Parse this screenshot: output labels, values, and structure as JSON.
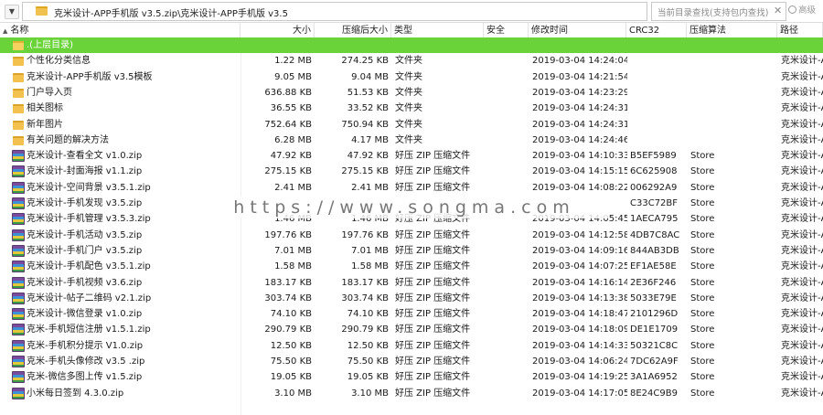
{
  "address": {
    "path": "克米设计-APP手机版 v3.5.zip\\克米设计-APP手机版 v3.5",
    "search_placeholder": "当前目录查找(支持包内查找)",
    "search_clear": "✕",
    "search_button": "高级"
  },
  "columns": {
    "name": "名称",
    "size": "大小",
    "packed": "压缩后大小",
    "type": "类型",
    "security": "安全",
    "modified": "修改时间",
    "crc": "CRC32",
    "algo": "压缩算法",
    "path": "路径"
  },
  "rows": [
    {
      "icon": "up",
      "name": ".(上层目录)",
      "size": "",
      "packed": "",
      "type": "",
      "modified": "",
      "crc": "",
      "algo": "",
      "path": ""
    },
    {
      "icon": "folder",
      "name": "个性化分类信息",
      "size": "1.22 MB",
      "packed": "274.25 KB",
      "type": "文件夹",
      "modified": "2019-03-04 14:24:04",
      "crc": "",
      "algo": "",
      "path": "克米设计-A"
    },
    {
      "icon": "folder",
      "name": "克米设计-APP手机版 v3.5模板",
      "size": "9.05 MB",
      "packed": "9.04 MB",
      "type": "文件夹",
      "modified": "2019-03-04 14:21:54",
      "crc": "",
      "algo": "",
      "path": "克米设计-A"
    },
    {
      "icon": "folder",
      "name": "门户导入页",
      "size": "636.88 KB",
      "packed": "51.53 KB",
      "type": "文件夹",
      "modified": "2019-03-04 14:23:29",
      "crc": "",
      "algo": "",
      "path": "克米设计-A"
    },
    {
      "icon": "folder",
      "name": "相关图标",
      "size": "36.55 KB",
      "packed": "33.52 KB",
      "type": "文件夹",
      "modified": "2019-03-04 14:24:31",
      "crc": "",
      "algo": "",
      "path": "克米设计-A"
    },
    {
      "icon": "folder",
      "name": "新年图片",
      "size": "752.64 KB",
      "packed": "750.94 KB",
      "type": "文件夹",
      "modified": "2019-03-04 14:24:31",
      "crc": "",
      "algo": "",
      "path": "克米设计-A"
    },
    {
      "icon": "folder",
      "name": "有关问题的解决方法",
      "size": "6.28 MB",
      "packed": "4.17 MB",
      "type": "文件夹",
      "modified": "2019-03-04 14:24:46",
      "crc": "",
      "algo": "",
      "path": "克米设计-A"
    },
    {
      "icon": "zip",
      "name": "克米设计-查看全文 v1.0.zip",
      "size": "47.92 KB",
      "packed": "47.92 KB",
      "type": "好压 ZIP 压缩文件",
      "modified": "2019-03-04 14:10:33",
      "crc": "B5EF5989",
      "algo": "Store",
      "path": "克米设计-A"
    },
    {
      "icon": "zip",
      "name": "克米设计-封面海报 v1.1.zip",
      "size": "275.15 KB",
      "packed": "275.15 KB",
      "type": "好压 ZIP 压缩文件",
      "modified": "2019-03-04 14:15:15",
      "crc": "6C625908",
      "algo": "Store",
      "path": "克米设计-A"
    },
    {
      "icon": "zip",
      "name": "克米设计-空间背景 v3.5.1.zip",
      "size": "2.41 MB",
      "packed": "2.41 MB",
      "type": "好压 ZIP 压缩文件",
      "modified": "2019-03-04 14:08:22",
      "crc": "006292A9",
      "algo": "Store",
      "path": "克米设计-A"
    },
    {
      "icon": "zip",
      "name": "克米设计-手机发现 v3.5.zip",
      "size": "",
      "packed": "",
      "type": "",
      "modified": "",
      "crc": "C33C72BF",
      "algo": "Store",
      "path": "克米设计-A"
    },
    {
      "icon": "zip",
      "name": "克米设计-手机管理 v3.5.3.zip",
      "size": "1.46 MB",
      "packed": "1.46 MB",
      "type": "好压 ZIP 压缩文件",
      "modified": "2019-03-04 14:05:45",
      "crc": "1AECA795",
      "algo": "Store",
      "path": "克米设计-A"
    },
    {
      "icon": "zip",
      "name": "克米设计-手机活动 v3.5.zip",
      "size": "197.76 KB",
      "packed": "197.76 KB",
      "type": "好压 ZIP 压缩文件",
      "modified": "2019-03-04 14:12:58",
      "crc": "4DB7C8AC",
      "algo": "Store",
      "path": "克米设计-A"
    },
    {
      "icon": "zip",
      "name": "克米设计-手机门户 v3.5.zip",
      "size": "7.01 MB",
      "packed": "7.01 MB",
      "type": "好压 ZIP 压缩文件",
      "modified": "2019-03-04 14:09:16",
      "crc": "844AB3DB",
      "algo": "Store",
      "path": "克米设计-A"
    },
    {
      "icon": "zip",
      "name": "克米设计-手机配色 v3.5.1.zip",
      "size": "1.58 MB",
      "packed": "1.58 MB",
      "type": "好压 ZIP 压缩文件",
      "modified": "2019-03-04 14:07:25",
      "crc": "EF1AE58E",
      "algo": "Store",
      "path": "克米设计-A"
    },
    {
      "icon": "zip",
      "name": "克米设计-手机视频 v3.6.zip",
      "size": "183.17 KB",
      "packed": "183.17 KB",
      "type": "好压 ZIP 压缩文件",
      "modified": "2019-03-04 14:16:14",
      "crc": "2E36F246",
      "algo": "Store",
      "path": "克米设计-A"
    },
    {
      "icon": "zip",
      "name": "克米设计-帖子二维码 v2.1.zip",
      "size": "303.74 KB",
      "packed": "303.74 KB",
      "type": "好压 ZIP 压缩文件",
      "modified": "2019-03-04 14:13:38",
      "crc": "5033E79E",
      "algo": "Store",
      "path": "克米设计-A"
    },
    {
      "icon": "zip",
      "name": "克米设计-微信登录 v1.0.zip",
      "size": "74.10 KB",
      "packed": "74.10 KB",
      "type": "好压 ZIP 压缩文件",
      "modified": "2019-03-04 14:18:47",
      "crc": "2101296D",
      "algo": "Store",
      "path": "克米设计-A"
    },
    {
      "icon": "zip",
      "name": "克米-手机短信注册 v1.5.1.zip",
      "size": "290.79 KB",
      "packed": "290.79 KB",
      "type": "好压 ZIP 压缩文件",
      "modified": "2019-03-04 14:18:09",
      "crc": "DE1E1709",
      "algo": "Store",
      "path": "克米设计-A"
    },
    {
      "icon": "zip",
      "name": "克米-手机积分提示 V1.0.zip",
      "size": "12.50 KB",
      "packed": "12.50 KB",
      "type": "好压 ZIP 压缩文件",
      "modified": "2019-03-04 14:14:33",
      "crc": "50321C8C",
      "algo": "Store",
      "path": "克米设计-A"
    },
    {
      "icon": "zip",
      "name": "克米-手机头像修改 v3.5 .zip",
      "size": "75.50 KB",
      "packed": "75.50 KB",
      "type": "好压 ZIP 压缩文件",
      "modified": "2019-03-04 14:06:24",
      "crc": "7DC62A9F",
      "algo": "Store",
      "path": "克米设计-A"
    },
    {
      "icon": "zip",
      "name": "克米-微信多图上传 v1.5.zip",
      "size": "19.05 KB",
      "packed": "19.05 KB",
      "type": "好压 ZIP 压缩文件",
      "modified": "2019-03-04 14:19:25",
      "crc": "3A1A6952",
      "algo": "Store",
      "path": "克米设计-A"
    },
    {
      "icon": "zip",
      "name": "小米每日签到 4.3.0.zip",
      "size": "3.10 MB",
      "packed": "3.10 MB",
      "type": "好压 ZIP 压缩文件",
      "modified": "2019-03-04 14:17:05",
      "crc": "8E24C9B9",
      "algo": "Store",
      "path": "克米设计-A"
    }
  ],
  "watermark": "https://www.songma.com",
  "colors": {
    "selected_row": "#6ad33a",
    "folder": "#f2c14e"
  }
}
